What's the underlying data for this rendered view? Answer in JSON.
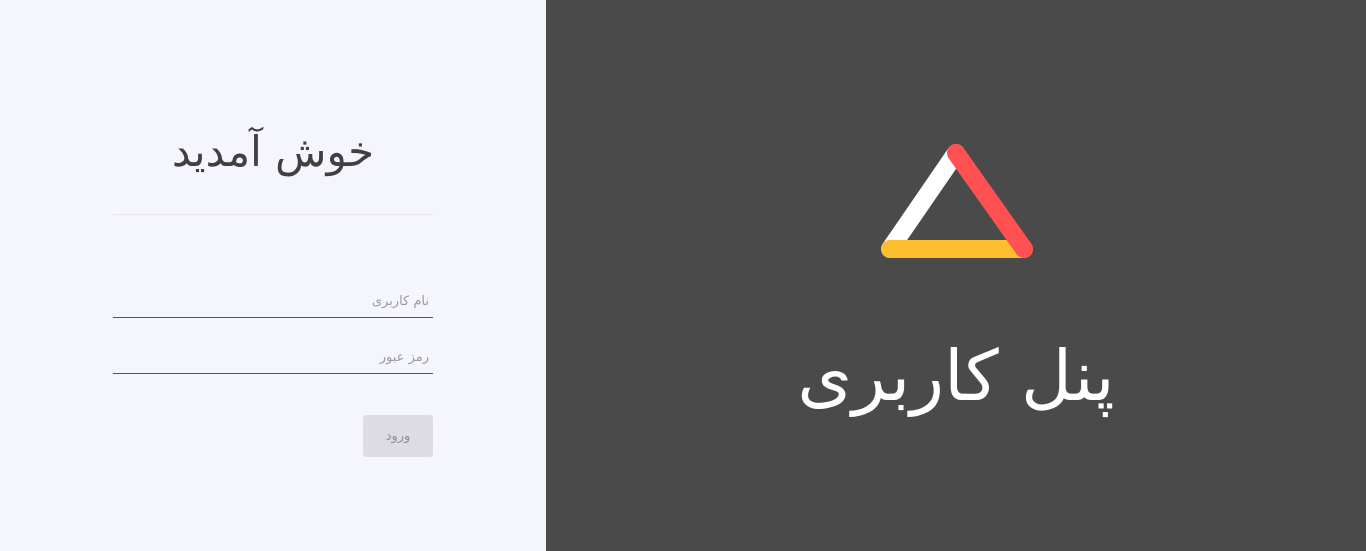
{
  "login": {
    "title": "خوش آمدید",
    "username_placeholder": "نام کاربری",
    "password_placeholder": "رمز عبور",
    "submit_label": "ورود"
  },
  "brand": {
    "logo_icon": "triangle-logo-icon",
    "logo_colors": {
      "left": "#ffffff",
      "right": "#ff5152",
      "bottom": "#fdbf2d"
    },
    "title": "پنل کاربری"
  },
  "colors": {
    "login_background": "#f5f6fd",
    "brand_background": "#4a4a4a",
    "button_background": "#dcdce2"
  }
}
